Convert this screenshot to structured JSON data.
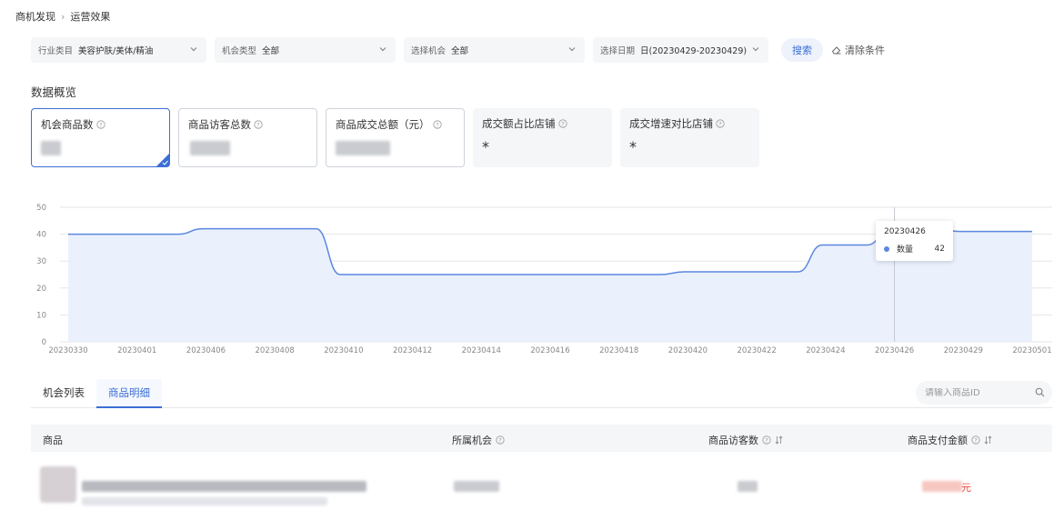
{
  "breadcrumb": {
    "root": "商机发现",
    "separator": "›",
    "current": "运营效果"
  },
  "filters": [
    {
      "label": "行业类目",
      "value": "美容护肤/美体/精油"
    },
    {
      "label": "机会类型",
      "value": "全部"
    },
    {
      "label": "选择机会",
      "value": "全部"
    },
    {
      "label": "选择日期",
      "value": "日(20230429-20230429)"
    }
  ],
  "actions": {
    "search": "搜索",
    "clear": "清除条件"
  },
  "overview": {
    "title": "数据概览",
    "cards": [
      {
        "title": "机会商品数",
        "value": ""
      },
      {
        "title": "商品访客总数",
        "value": ""
      },
      {
        "title": "商品成交总额（元）",
        "value": ""
      },
      {
        "title": "成交额占比店铺",
        "value": "*"
      },
      {
        "title": "成交增速对比店铺",
        "value": "*"
      }
    ]
  },
  "colors": {
    "accent": "#3b6fd6",
    "line": "#5b87e0",
    "area": "#eaf1fd",
    "money": "#e84c3d"
  },
  "chart_data": {
    "type": "area",
    "x": [
      "20230330",
      "20230401",
      "20230406",
      "20230408",
      "20230410",
      "20230412",
      "20230414",
      "20230416",
      "20230418",
      "20230420",
      "20230422",
      "20230424",
      "20230426",
      "20230429",
      "20230501"
    ],
    "series": [
      {
        "values": [
          40,
          40,
          42,
          42,
          25,
          25,
          25,
          25,
          25,
          26,
          26,
          36,
          42,
          41,
          41
        ]
      }
    ],
    "ylim": [
      0,
      50
    ],
    "yticks": [
      0,
      10,
      20,
      30,
      40,
      50
    ],
    "grid": true,
    "tooltip": {
      "date": "20230426",
      "label": "数量",
      "value": "42"
    }
  },
  "tabs": [
    {
      "label": "机会列表"
    },
    {
      "label": "商品明细"
    }
  ],
  "product_search": {
    "placeholder": "请输入商品ID"
  },
  "table": {
    "columns": [
      "商品",
      "所属机会",
      "商品访客数",
      "商品支付金额"
    ],
    "rows": [
      {
        "amount_suffix": "元"
      }
    ]
  },
  "icons": [
    "chevron-down-icon",
    "eraser-icon",
    "help-icon",
    "search-icon",
    "sort-icon",
    "check-corner-icon"
  ]
}
